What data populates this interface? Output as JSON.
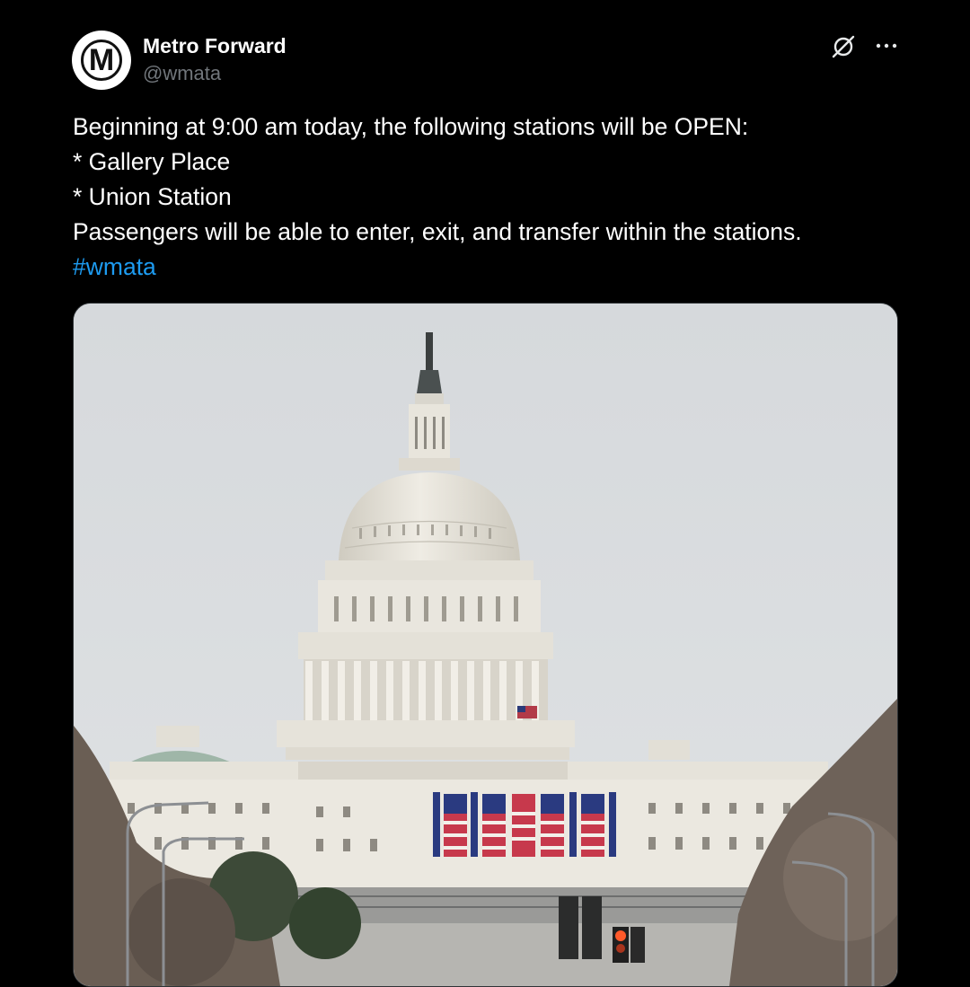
{
  "author": {
    "display_name": "Metro Forward",
    "handle": "@wmata",
    "avatar_letter": "M"
  },
  "icons": {
    "grok": "slashed-circle-icon",
    "more": "more-horizontal-icon"
  },
  "tweet": {
    "lines": [
      "Beginning at 9:00 am today, the following stations will be OPEN:",
      "* Gallery Place",
      "* Union Station",
      "Passengers will be able to enter, exit, and transfer within the stations."
    ],
    "hashtag": "#wmata"
  },
  "media": {
    "description_icon": "capitol-building-photo"
  },
  "colors": {
    "background": "#000000",
    "text": "#ffffff",
    "secondary_text": "#71767b",
    "link": "#1d9bf0"
  }
}
